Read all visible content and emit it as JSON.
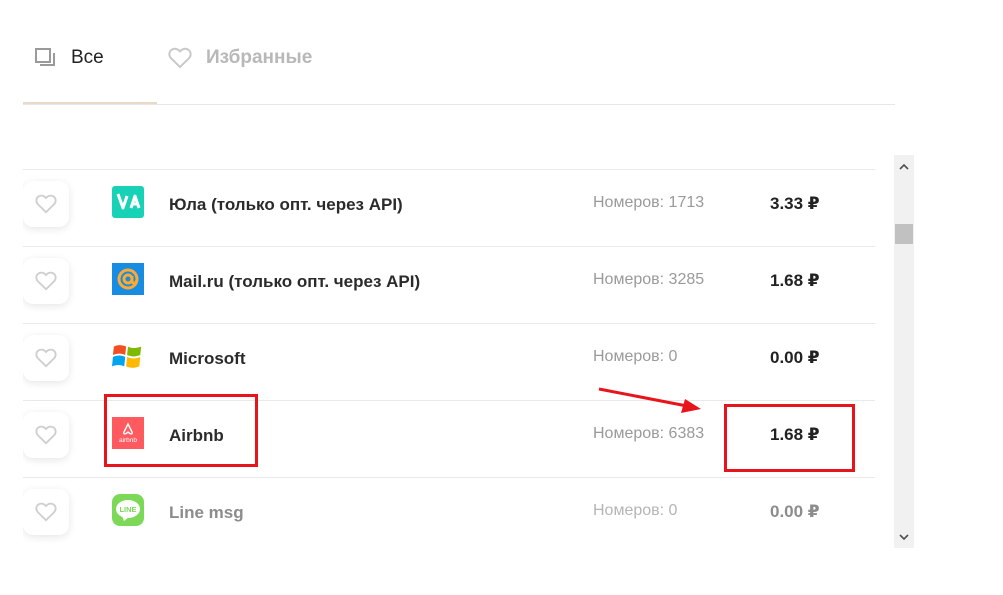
{
  "tabs": [
    {
      "label": "Все",
      "icon": "copy-icon",
      "active": true
    },
    {
      "label": "Избранные",
      "icon": "heart-icon",
      "active": false
    }
  ],
  "services": [
    {
      "name": "Юла (только опт. через API)",
      "count": "Номеров: 1713",
      "price": "3.33 ₽",
      "logo": "yula-logo-icon",
      "logo_color": "#17d2b7"
    },
    {
      "name": "Mail.ru (только опт. через API)",
      "count": "Номеров: 3285",
      "price": "1.68 ₽",
      "logo": "mailru-logo-icon",
      "logo_color": "#168de2"
    },
    {
      "name": "Microsoft",
      "count": "Номеров: 0",
      "price": "0.00 ₽",
      "logo": "windows-logo-icon",
      "logo_color": "#f25022"
    },
    {
      "name": "Airbnb",
      "count": "Номеров: 6383",
      "price": "1.68 ₽",
      "logo": "airbnb-logo-icon",
      "logo_color": "#ff5a5f",
      "logo_text": "airbnb"
    },
    {
      "name": "Line msg",
      "count": "Номеров: 0",
      "price": "0.00 ₽",
      "logo": "line-logo-icon",
      "logo_color": "#3acd01",
      "logo_text": "LINE"
    }
  ],
  "colors": {
    "annotation": "#e8141b",
    "tab_underline": "#ead9c9"
  }
}
